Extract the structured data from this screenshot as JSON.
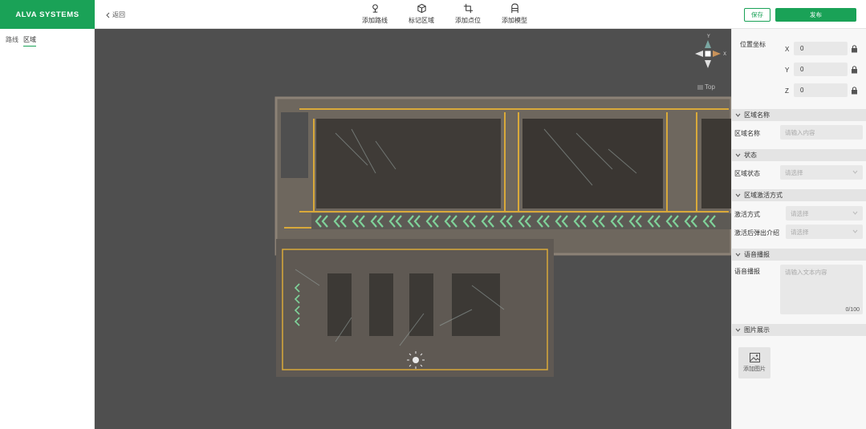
{
  "header": {
    "brand": "ALVA SYSTEMS",
    "back_label": "返回",
    "tools": [
      {
        "label": "添加路线",
        "icon": "route-icon"
      },
      {
        "label": "标记区域",
        "icon": "cube-icon"
      },
      {
        "label": "添加点位",
        "icon": "crop-icon"
      },
      {
        "label": "添加模型",
        "icon": "model-icon"
      }
    ],
    "save_label": "保存",
    "publish_label": "发布"
  },
  "left_panel": {
    "tabs": [
      {
        "label": "路线",
        "active": false
      },
      {
        "label": "区域",
        "active": true
      }
    ]
  },
  "viewport": {
    "gizmo": {
      "y_label": "Y",
      "x_label": "X"
    },
    "view_label": "Top"
  },
  "properties": {
    "position_title": "位置坐标",
    "coordinates": [
      {
        "axis": "X",
        "value": "0"
      },
      {
        "axis": "Y",
        "value": "0"
      },
      {
        "axis": "Z",
        "value": "0"
      }
    ],
    "sections": {
      "area_name": {
        "title": "区域名称",
        "label": "区域名称",
        "placeholder": "请输入内容"
      },
      "status": {
        "title": "状态",
        "label": "区域状态",
        "placeholder": "请选择"
      },
      "activation": {
        "title": "区域激活方式",
        "method_label": "激活方式",
        "method_placeholder": "请选择",
        "popup_label": "激活后弹出介绍",
        "popup_placeholder": "请选择"
      },
      "voice": {
        "title": "语音播报",
        "label": "语音播报",
        "placeholder": "请输入文本内容",
        "counter": "0/100"
      },
      "images": {
        "title": "图片展示",
        "add_label": "添加图片"
      }
    }
  },
  "colors": {
    "brand_green": "#1aa257",
    "viewport_bg": "#4f4f4f",
    "arrow_green": "#7fd39a",
    "floor_line": "#d9a93a"
  }
}
